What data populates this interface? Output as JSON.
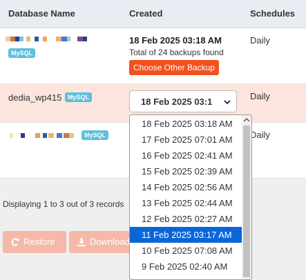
{
  "table": {
    "headers": [
      "Database Name",
      "Created",
      "Schedules"
    ],
    "rows": [
      {
        "db_badge": "MySQL",
        "created_date": "18 Feb 2025 03:18 AM",
        "backup_count": "Total of 24 backups found",
        "choose_button": "Choose Other Backup",
        "schedule": "Daily"
      },
      {
        "db_name": "dedia_wp415",
        "db_badge": "MySQL",
        "selected_backup": "18 Feb 2025 03:1",
        "schedule": "Daily"
      },
      {
        "db_badge": "MySQL",
        "schedule": "Daily"
      }
    ]
  },
  "dropdown": {
    "options": [
      "18 Feb 2025 03:18 AM",
      "17 Feb 2025 07:01 AM",
      "16 Feb 2025 02:41 AM",
      "15 Feb 2025 02:39 AM",
      "14 Feb 2025 02:56 AM",
      "13 Feb 2025 02:44 AM",
      "12 Feb 2025 02:27 AM",
      "11 Feb 2025 03:17 AM",
      "10 Feb 2025 07:08 AM",
      "9 Feb 2025 02:40 AM"
    ],
    "highlighted": "11 Feb 2025 03:17 AM"
  },
  "footer": {
    "records_text": "Displaying 1 to 3 out of 3 records"
  },
  "actions": {
    "restore_label": "Restore",
    "download_label": "Download"
  },
  "colors": {
    "header_bg": "#e9ecf2",
    "row_highlight": "#fce5dc",
    "badge": "#5bc0de",
    "orange_button": "#f4511e",
    "disabled_button": "#f6b8a8",
    "option_selected": "#0a66d8"
  },
  "icons": {
    "select_chevron": "chevron-down-icon",
    "restore": "refresh-icon",
    "download": "download-icon"
  }
}
